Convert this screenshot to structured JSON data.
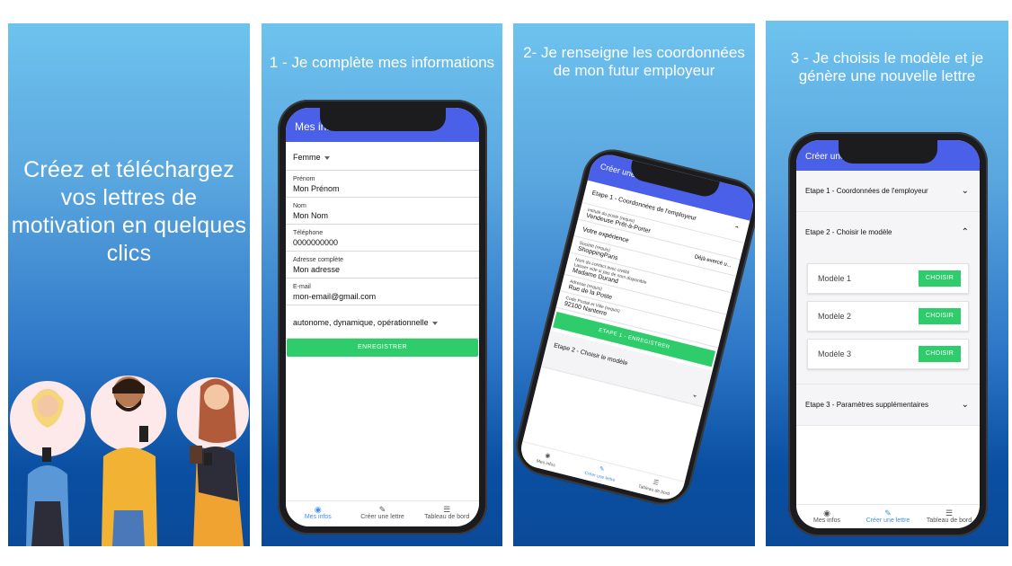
{
  "panel1": {
    "headline": "Créez et téléchargez vos lettres de motivation en quelques clics"
  },
  "panel2": {
    "caption": "1 - Je complète mes informations",
    "appbar_title": "Mes infos",
    "gender_select": "Femme",
    "fields": [
      {
        "label": "Prénom",
        "value": "Mon Prénom"
      },
      {
        "label": "Nom",
        "value": "Mon Nom"
      },
      {
        "label": "Téléphone",
        "value": "0000000000"
      },
      {
        "label": "Adresse complète",
        "value": "Mon adresse"
      },
      {
        "label": "E-mail",
        "value": "mon-email@gmail.com"
      }
    ],
    "qualities_select": "autonome, dynamique, opérationnelle",
    "save_button": "ENREGISTRER",
    "nav": [
      "Mes infos",
      "Créer une lettre",
      "Tableau de bord"
    ]
  },
  "panel3": {
    "caption": "2- Je renseigne les coordonnées de mon futur employeur",
    "appbar_title": "Créer une le",
    "step1": "Etape 1 - Coordonnées de l'employeur",
    "fields": [
      {
        "label": "Intitulé du poste (requis)",
        "value": "Vendeuse Prêt-à-Porter"
      },
      {
        "label": "Votre expérience",
        "value": "Déjà exercé u..."
      },
      {
        "label": "Société (requis)",
        "value": "ShoppingParis"
      },
      {
        "label": "Nom du contact avec civilité",
        "value": "Madame Durand"
      },
      {
        "label": "Adresse (requis)",
        "value": "Rue de la Poste"
      },
      {
        "label": "Code Postal et Ville (requis)",
        "value": "92100 Nanterre"
      }
    ],
    "contact_hint": "Laisser vide si pas de nom disponible",
    "save_button": "ETAPE 1 - ENREGISTRER",
    "step2": "Etape 2 - Choisir le modèle",
    "nav": [
      "Mes infos",
      "Créer une lettre",
      "Tableau de bord"
    ]
  },
  "panel4": {
    "caption": "3 - Je choisis le modèle et je génère une nouvelle lettre",
    "appbar_title": "Créer une",
    "step1": "Etape 1 - Coordonnées de l'employeur",
    "step2": "Etape 2 - Choisir le modèle",
    "models": [
      "Modèle 1",
      "Modèle 2",
      "Modèle 3"
    ],
    "choose_label": "CHOISIR",
    "step3": "Etape 3 - Paramètres supplémentaires",
    "nav": [
      "Mes infos",
      "Créer une lettre",
      "Tableau de bord"
    ]
  }
}
